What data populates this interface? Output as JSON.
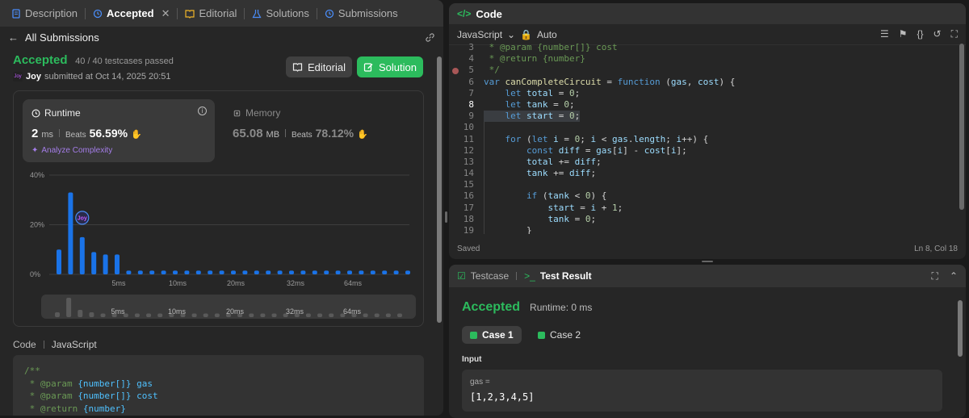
{
  "tabs": {
    "description": "Description",
    "accepted": "Accepted",
    "editorial": "Editorial",
    "solutions": "Solutions",
    "submissions": "Submissions"
  },
  "subheader": {
    "back_label": "All Submissions"
  },
  "result": {
    "status": "Accepted",
    "testcases": "40 / 40 testcases passed",
    "user": "Joy",
    "submitted_text": "submitted at Oct 14, 2025 20:51",
    "avatar_text": "Joy"
  },
  "buttons": {
    "editorial": "Editorial",
    "solution": "Solution"
  },
  "runtime": {
    "title": "Runtime",
    "value": "2",
    "unit": "ms",
    "beats_label": "Beats",
    "beats_pct": "56.59%",
    "analyze": "Analyze Complexity"
  },
  "memory": {
    "title": "Memory",
    "value": "65.08",
    "unit": "MB",
    "beats_label": "Beats",
    "beats_pct": "78.12%"
  },
  "chart_data": {
    "type": "bar",
    "y_ticks": [
      "40%",
      "20%",
      "0%"
    ],
    "ylim": [
      0,
      40
    ],
    "x_ticks": [
      "5ms",
      "10ms",
      "20ms",
      "32ms",
      "64ms"
    ],
    "values": [
      10,
      33,
      15,
      9,
      8,
      8,
      1.5,
      1.5,
      1.5,
      1.5,
      1.5,
      1.5,
      1.5,
      1.5,
      1.5,
      1.5,
      1.5,
      1.5,
      1.5,
      1.5,
      1.5,
      1.5,
      1.5,
      1.5,
      1.5,
      1.5,
      1.5,
      1.5,
      1.5,
      1.5,
      1.5
    ],
    "highlight_index": 2,
    "highlight_label": "Joy",
    "mini_values": [
      2,
      8,
      3,
      2,
      1.5,
      1.5,
      1.5,
      1.5,
      1.5,
      1.5,
      1.5,
      1.5,
      1.5,
      1.5,
      1.5,
      1.5,
      1.5,
      1.5,
      1.5,
      1.5,
      1.5,
      1.5,
      1.5,
      1.5,
      1.5,
      1.5,
      1.5,
      1.5,
      1.5,
      1.5,
      1.5
    ],
    "colors": {
      "bar": "#1a73e8",
      "mini_bar": "#5a5a5a"
    }
  },
  "code_section": {
    "label": "Code",
    "language": "JavaScript",
    "lines": [
      "/**",
      " * @param {number[]} gas",
      " * @param {number[]} cost",
      " * @return {number}"
    ]
  },
  "editor": {
    "title": "Code",
    "language": "JavaScript",
    "mode": "Auto",
    "status_left": "Saved",
    "status_right": "Ln 8, Col 18",
    "lines": [
      {
        "n": "3",
        "t": " * @param {number[]} cost"
      },
      {
        "n": "4",
        "t": " * @return {number}"
      },
      {
        "n": "5",
        "t": " */"
      },
      {
        "n": "6",
        "t": "var canCompleteCircuit = function (gas, cost) {"
      },
      {
        "n": "7",
        "t": "    let total = 0;"
      },
      {
        "n": "8",
        "t": "    let tank = 0;"
      },
      {
        "n": "9",
        "t": "    let start = 0;"
      },
      {
        "n": "10",
        "t": ""
      },
      {
        "n": "11",
        "t": "    for (let i = 0; i < gas.length; i++) {"
      },
      {
        "n": "12",
        "t": "        const diff = gas[i] - cost[i];"
      },
      {
        "n": "13",
        "t": "        total += diff;"
      },
      {
        "n": "14",
        "t": "        tank += diff;"
      },
      {
        "n": "15",
        "t": ""
      },
      {
        "n": "16",
        "t": "        if (tank < 0) {"
      },
      {
        "n": "17",
        "t": "            start = i + 1;"
      },
      {
        "n": "18",
        "t": "            tank = 0;"
      },
      {
        "n": "19",
        "t": "        }"
      }
    ]
  },
  "tests": {
    "tab_testcase": "Testcase",
    "tab_result": "Test Result",
    "status": "Accepted",
    "runtime": "Runtime: 0 ms",
    "case1": "Case 1",
    "case2": "Case 2",
    "input_label": "Input",
    "input_name": "gas =",
    "input_value": "[1,2,3,4,5]"
  }
}
